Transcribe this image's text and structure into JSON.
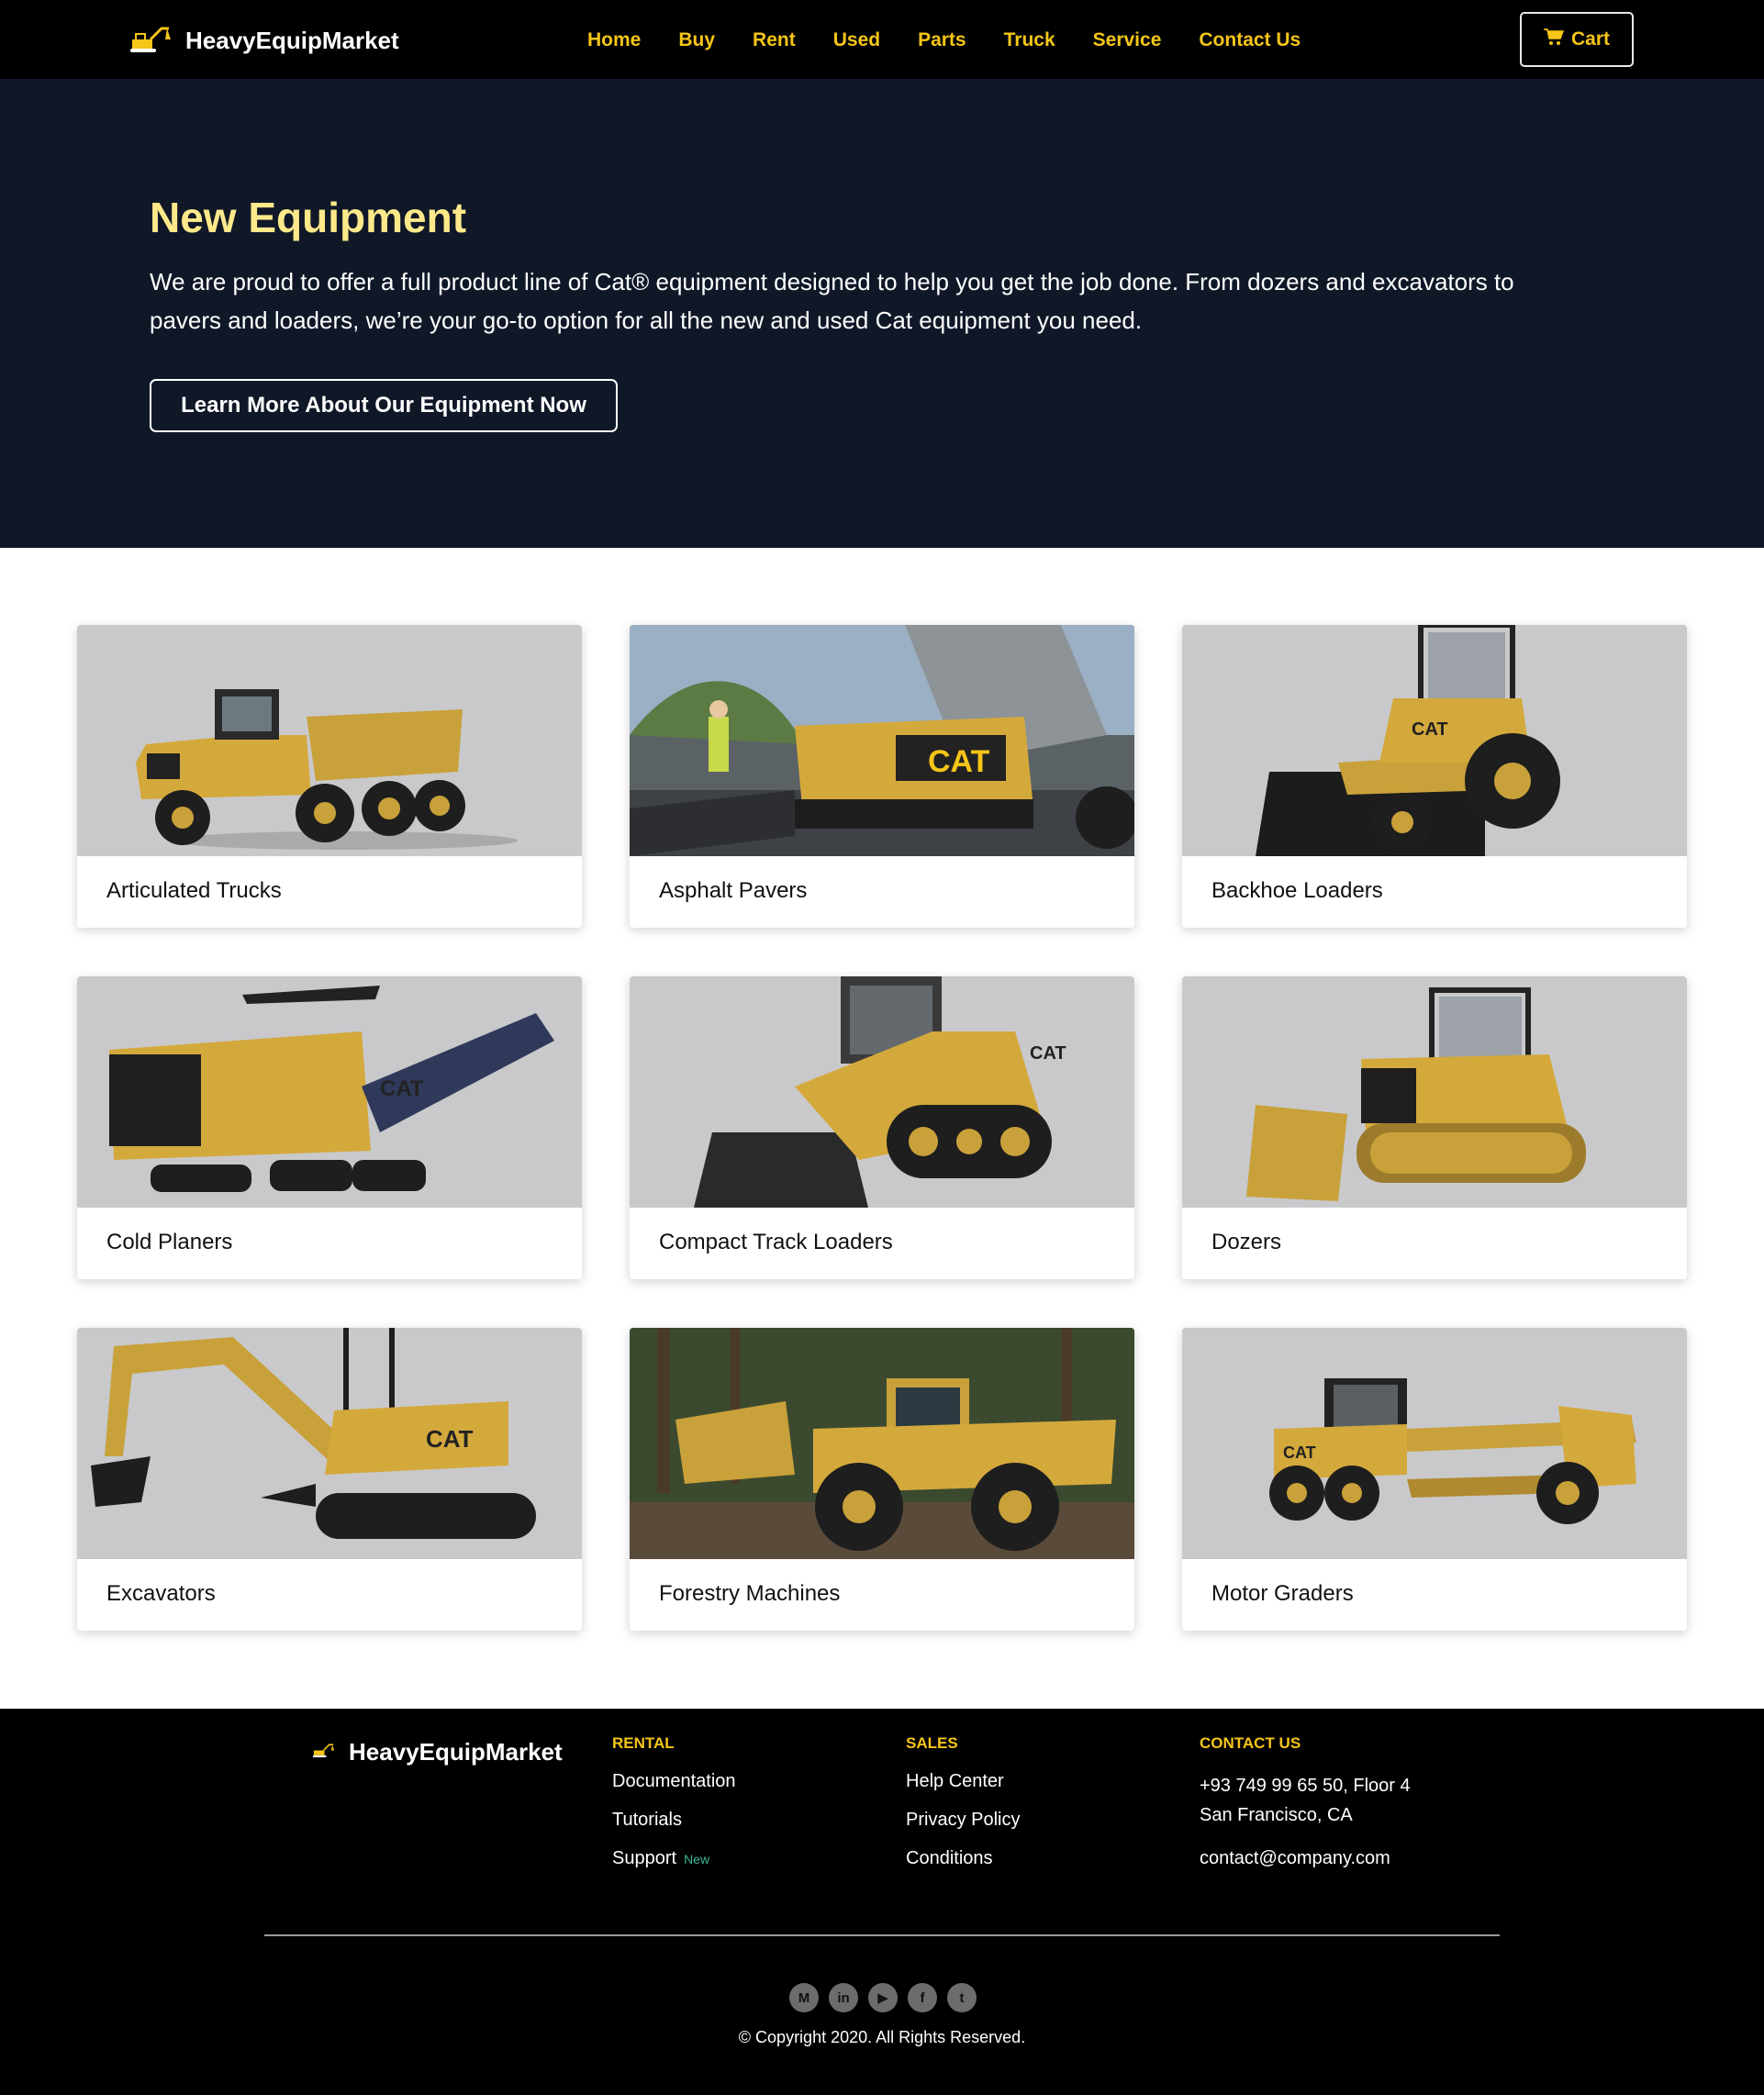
{
  "nav": {
    "brand": "HeavyEquipMarket",
    "links": [
      "Home",
      "Buy",
      "Rent",
      "Used",
      "Parts",
      "Truck",
      "Service",
      "Contact Us"
    ],
    "cart_label": "Cart"
  },
  "hero": {
    "title": "New Equipment",
    "text": "We are proud to offer a full product line of Cat® equipment designed to help you get the job done. From dozers and excavators to pavers and loaders, we’re your go-to option for all the new and used Cat equipment you need.",
    "button": "Learn More About Our Equipment Now"
  },
  "equipment": [
    {
      "label": "Articulated Trucks",
      "icon": "articulated-truck-image"
    },
    {
      "label": "Asphalt Pavers",
      "icon": "asphalt-paver-image"
    },
    {
      "label": "Backhoe Loaders",
      "icon": "backhoe-loader-image"
    },
    {
      "label": "Cold Planers",
      "icon": "cold-planer-image"
    },
    {
      "label": "Compact Track Loaders",
      "icon": "compact-track-loader-image"
    },
    {
      "label": "Dozers",
      "icon": "dozer-image"
    },
    {
      "label": "Excavators",
      "icon": "excavator-image"
    },
    {
      "label": "Forestry Machines",
      "icon": "forestry-machine-image"
    },
    {
      "label": "Motor Graders",
      "icon": "motor-grader-image"
    }
  ],
  "footer": {
    "brand": "HeavyEquipMarket",
    "rental": {
      "heading": "RENTAL",
      "links": [
        "Documentation",
        "Tutorials",
        "Support"
      ],
      "badge": "New"
    },
    "sales": {
      "heading": "SALES",
      "links": [
        "Help Center",
        "Privacy Policy",
        "Conditions"
      ]
    },
    "contact": {
      "heading": "CONTACT US",
      "address_line1": "+93 749 99 65 50, Floor 4",
      "address_line2": "San Francisco, CA",
      "email": "contact@company.com"
    },
    "social_icons": [
      "M",
      "in",
      "▶",
      "f",
      "t"
    ],
    "copyright": "© Copyright 2020. All Rights Reserved."
  },
  "colors": {
    "accent": "#f5c518",
    "hero_bg": "#101828",
    "hero_title": "#fde98a",
    "footer_bg": "#000000"
  }
}
